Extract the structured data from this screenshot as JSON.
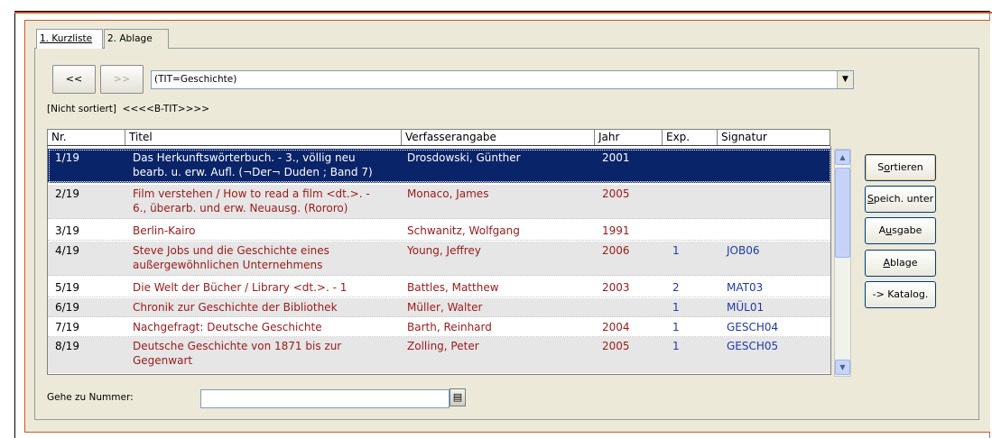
{
  "tabs": [
    {
      "label": "1. Kurzliste",
      "active": true
    },
    {
      "label": "2. Ablage",
      "active": false
    }
  ],
  "nav": {
    "prev": "<<",
    "next": ">>"
  },
  "query": "(TIT=Geschichte)",
  "sort_status": "[Nicht sortiert]  <<<<B-TIT>>>>",
  "columns": [
    "Nr.",
    "Titel",
    "Verfasserangabe",
    "Jahr",
    "Exp.",
    "Signatur"
  ],
  "rows": [
    {
      "nr": "1/19",
      "title": "Das Herkunftswörterbuch. - 3., völlig neu\nbearb. u. erw. Aufl. (¬Der¬ Duden ; Band 7)",
      "author": "Drosdowski, Günther",
      "year": "2001",
      "exp": "",
      "sig": ""
    },
    {
      "nr": "2/19",
      "title": "Film verstehen / How to read a film <dt.>. -\n6., überarb. und erw. Neuausg. (Rororo)",
      "author": "Monaco, James",
      "year": "2005",
      "exp": "",
      "sig": ""
    },
    {
      "nr": "3/19",
      "title": "Berlin-Kairo",
      "author": "Schwanitz, Wolfgang",
      "year": "1991",
      "exp": "",
      "sig": ""
    },
    {
      "nr": "4/19",
      "title": "Steve Jobs und die Geschichte eines\naußergewöhnlichen Unternehmens",
      "author": "Young, Jeffrey",
      "year": "2006",
      "exp": "1",
      "sig": "JOB06"
    },
    {
      "nr": "5/19",
      "title": "Die Welt der Bücher / Library <dt.>. - 1",
      "author": "Battles, Matthew",
      "year": "2003",
      "exp": "2",
      "sig": "MAT03"
    },
    {
      "nr": "6/19",
      "title": "Chronik zur Geschichte der Bibliothek",
      "author": "Müller, Walter",
      "year": "",
      "exp": "1",
      "sig": "MÜL01"
    },
    {
      "nr": "7/19",
      "title": "Nachgefragt: Deutsche Geschichte",
      "author": "Barth, Reinhard",
      "year": "2004",
      "exp": "1",
      "sig": "GESCH04"
    },
    {
      "nr": "8/19",
      "title": "Deutsche Geschichte von 1871 bis zur\nGegenwart",
      "author": "Zolling, Peter",
      "year": "2005",
      "exp": "1",
      "sig": "GESCH05"
    }
  ],
  "side_buttons": [
    {
      "pre": "S",
      "u": "o",
      "post": "rtieren"
    },
    {
      "pre": "",
      "u": "S",
      "post": "peich. unter"
    },
    {
      "pre": "A",
      "u": "u",
      "post": "sgabe"
    },
    {
      "pre": "",
      "u": "A",
      "post": "blage"
    },
    {
      "pre": "-> Katalog.",
      "u": "",
      "post": ""
    }
  ],
  "goto_label": "Gehe zu Nummer:",
  "goto_value": "",
  "colors": {
    "accent": "#c8582b",
    "selection": "#0a246a",
    "title_text": "#9b1a1a",
    "signature_text": "#1f3aa5"
  },
  "icons": {
    "dropdown": "triangle-down",
    "goto": "list-picker"
  }
}
